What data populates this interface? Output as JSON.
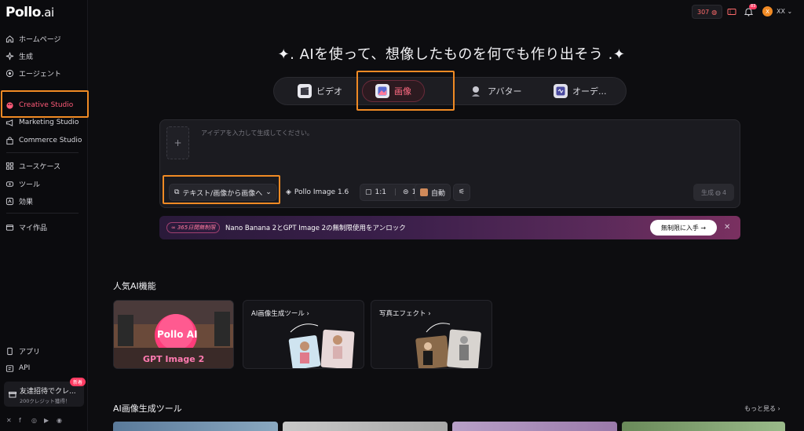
{
  "brand": {
    "name": "Pollo",
    "suffix": ".ai"
  },
  "sidebar": {
    "items": [
      {
        "label": "ホームページ",
        "icon": "home-icon"
      },
      {
        "label": "生成",
        "icon": "sparkle-icon"
      },
      {
        "label": "エージェント",
        "icon": "agent-icon"
      },
      {
        "label": "Creative Studio",
        "icon": "palette-icon"
      },
      {
        "label": "Marketing Studio",
        "icon": "megaphone-icon"
      },
      {
        "label": "Commerce Studio",
        "icon": "bag-icon"
      },
      {
        "label": "ユースケース",
        "icon": "grid-icon"
      },
      {
        "label": "ツール",
        "icon": "tool-icon"
      },
      {
        "label": "効果",
        "icon": "effects-icon"
      },
      {
        "label": "マイ作品",
        "icon": "folder-icon"
      },
      {
        "label": "アプリ",
        "icon": "app-icon"
      },
      {
        "label": "API",
        "icon": "api-icon"
      }
    ],
    "invite": {
      "title": "友達招待でクレ...",
      "subtitle": "200クレジット獲得！",
      "badge": "新着"
    }
  },
  "topbar": {
    "credits": "307",
    "notif_count": "83",
    "avatar_letter": "X",
    "user_name": "XX"
  },
  "hero": {
    "title": "✦. AIを使って、想像したものを何でも作り出そう .✦"
  },
  "tabs": [
    {
      "label": "ビデオ"
    },
    {
      "label": "画像"
    },
    {
      "label": "アバター"
    },
    {
      "label": "オーデ..."
    }
  ],
  "prompt": {
    "placeholder": "アイデアを入力して生成してください。",
    "mode": "テキスト/画像から画像へ",
    "model": "Pollo Image 1.6",
    "ratio": "1:1",
    "count": "1",
    "auto": "自動",
    "generate": "生成",
    "generate_cost": "4"
  },
  "banner": {
    "pill": "365日間無制限",
    "message": "Nano Banana 2とGPT Image 2の無制限使用をアンロック",
    "cta": "無制限に入手 →"
  },
  "popular": {
    "title": "人気AI機能",
    "cards": [
      {
        "label": "",
        "overlay1": "Pollo AI",
        "overlay2": "GPT Image 2"
      },
      {
        "label": "AI画像生成ツール"
      },
      {
        "label": "写真エフェクト"
      }
    ]
  },
  "tools": {
    "title": "AI画像生成ツール",
    "more": "もっと見る"
  }
}
